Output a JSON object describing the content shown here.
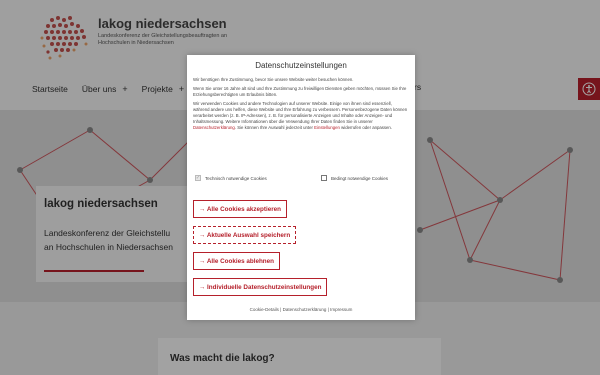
{
  "brand": {
    "title": "lakog niedersachsen",
    "subtitle": "Landeskonferenz der Gleichstellungsbeauftragten an Hochschulen in Niedersachsen"
  },
  "nav": {
    "items": [
      {
        "label": "Startseite"
      },
      {
        "label": "Über uns",
        "plus": "+"
      },
      {
        "label": "Projekte",
        "plus": "+"
      }
    ],
    "extra": "rs"
  },
  "a11y": {
    "icon": "accessibility-icon"
  },
  "hero": {
    "title": "lakog niedersachsen",
    "line1": "Landeskonferenz der Gleichstellu",
    "line2": "an Hochschulen in Niedersachsen"
  },
  "lower": {
    "title": "Was macht die lakog?"
  },
  "cookie_modal": {
    "title": "Datenschutzeinstellungen",
    "p1": "Wir benötigen Ihre Zustimmung, bevor Sie unsere Website weiter besuchen können.",
    "p2": "Wenn Sie unter 16 Jahre alt sind und Ihre Zustimmung zu freiwilligen Diensten geben möchten, müssen Sie Ihre Erziehungsberechtigten um Erlaubnis bitten.",
    "p3_a": "Wir verwenden Cookies und andere Technologien auf unserer Website. Einige von ihnen sind essenziell, während andere uns helfen, diese Website und Ihre Erfahrung zu verbessern. Personenbezogene Daten können verarbeitet werden (z. B. IP-Adressen), z. B. für personalisierte Anzeigen und Inhalte oder Anzeigen- und Inhaltsmessung. Weitere Informationen über die Verwendung Ihrer Daten finden Sie in unserer",
    "p3_link1": "Datenschutzerklärung",
    "p3_b": ". Sie können Ihre Auswahl jederzeit unter",
    "p3_link2": "Einstellungen",
    "p3_c": "widerrufen oder anpassen.",
    "check_essential": "Technisch notwendige Cookies",
    "check_conditional": "Bedingt notwendige Cookies",
    "check_mark": "✓",
    "btn_accept_all": "→ Alle Cookies akzeptieren",
    "btn_save_selection": "→ Aktuelle Auswahl speichern",
    "btn_reject_all": "→ Alle Cookies ablehnen",
    "btn_individual": "→ Individuelle Datenschutzeinstellungen",
    "footer_links": [
      {
        "label": "Cookie-Details"
      },
      {
        "label": "Datenschutzerklärung"
      },
      {
        "label": "Impressum"
      }
    ],
    "footer_sep": "|"
  }
}
